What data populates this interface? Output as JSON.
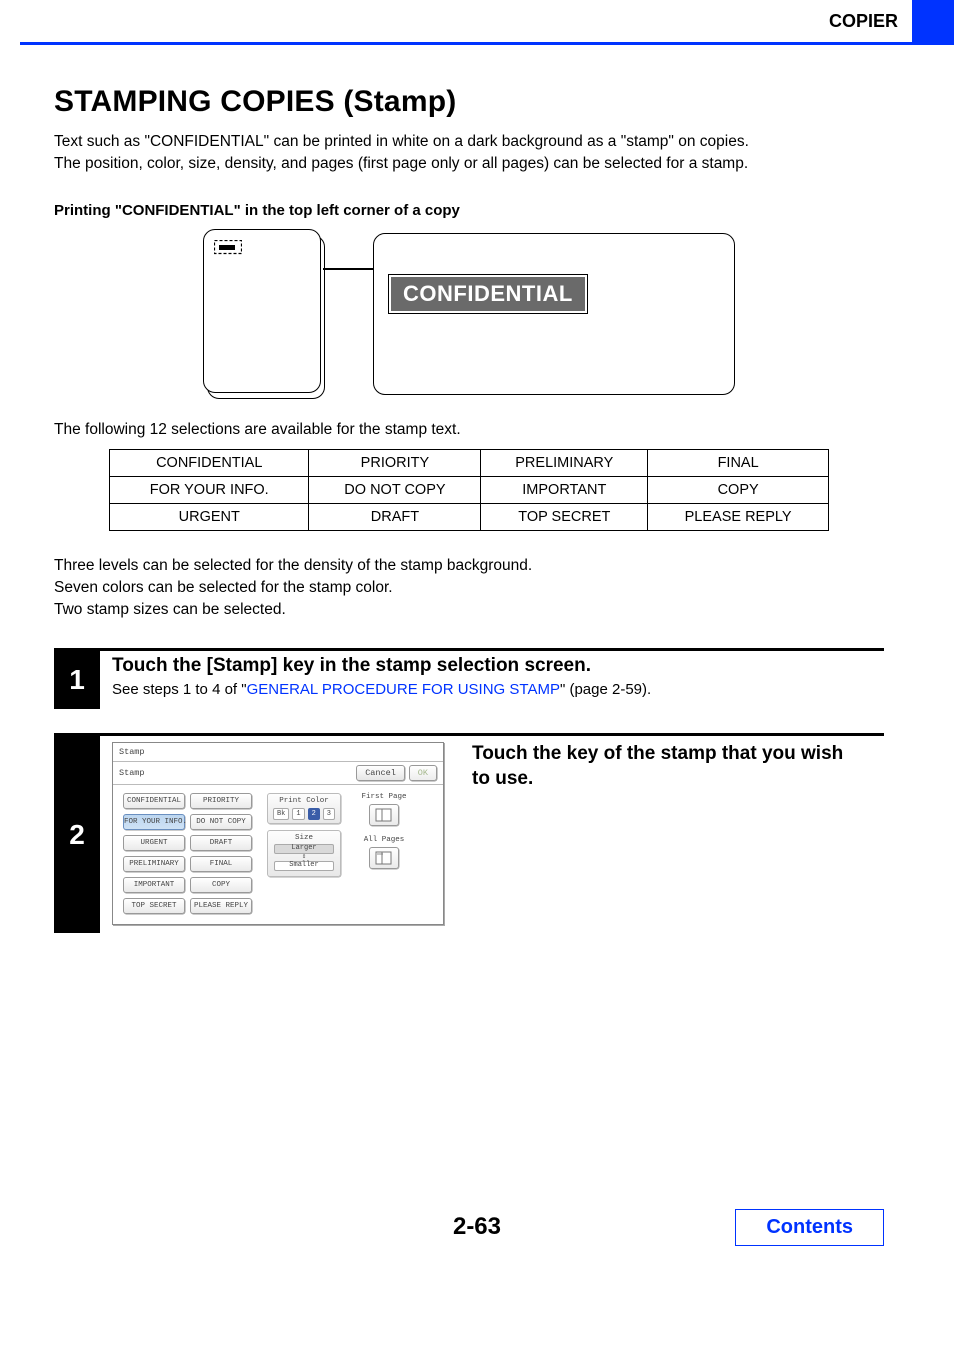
{
  "header": {
    "section": "COPIER"
  },
  "title": "STAMPING COPIES (Stamp)",
  "intro_line1": "Text such as \"CONFIDENTIAL\" can be printed in white on a dark background as a \"stamp\" on copies.",
  "intro_line2": "The position, color, size, density, and pages (first page only or all pages) can be selected for a stamp.",
  "example_heading": "Printing \"CONFIDENTIAL\" in the top left corner of a copy",
  "stamp_sample": "CONFIDENTIAL",
  "selections_intro": "The following 12 selections are available for the stamp text.",
  "stamps": [
    [
      "CONFIDENTIAL",
      "PRIORITY",
      "PRELIMINARY",
      "FINAL"
    ],
    [
      "FOR YOUR INFO.",
      "DO NOT COPY",
      "IMPORTANT",
      "COPY"
    ],
    [
      "URGENT",
      "DRAFT",
      "TOP SECRET",
      "PLEASE REPLY"
    ]
  ],
  "notes": {
    "l1": "Three levels can be selected for the density of the stamp background.",
    "l2": "Seven colors can be selected for the stamp color.",
    "l3": "Two stamp sizes can be selected."
  },
  "step1": {
    "num": "1",
    "title": "Touch the [Stamp] key in the stamp selection screen.",
    "sub_prefix": "See steps 1 to 4 of \"",
    "sub_link": "GENERAL PROCEDURE FOR USING STAMP",
    "sub_suffix": "\" (page 2-59)."
  },
  "step2": {
    "num": "2",
    "title": "Touch the key of the stamp that you wish to use."
  },
  "panel": {
    "screen_title": "Stamp",
    "tab_label": "Stamp",
    "cancel": "Cancel",
    "ok": "OK",
    "options": [
      "CONFIDENTIAL",
      "PRIORITY",
      "FOR YOUR INFO.",
      "DO NOT COPY",
      "URGENT",
      "DRAFT",
      "PRELIMINARY",
      "FINAL",
      "IMPORTANT",
      "COPY",
      "TOP SECRET",
      "PLEASE REPLY"
    ],
    "selected_option": "FOR YOUR INFO.",
    "print_color_label": "Print Color",
    "color_bk": "Bk",
    "color_1": "1",
    "color_2": "2",
    "color_3": "3",
    "size_label": "Size",
    "size_larger": "Larger",
    "size_smaller": "Smaller",
    "first_page": "First Page",
    "all_pages": "All Pages"
  },
  "footer": {
    "page_number": "2-63",
    "contents": "Contents"
  }
}
